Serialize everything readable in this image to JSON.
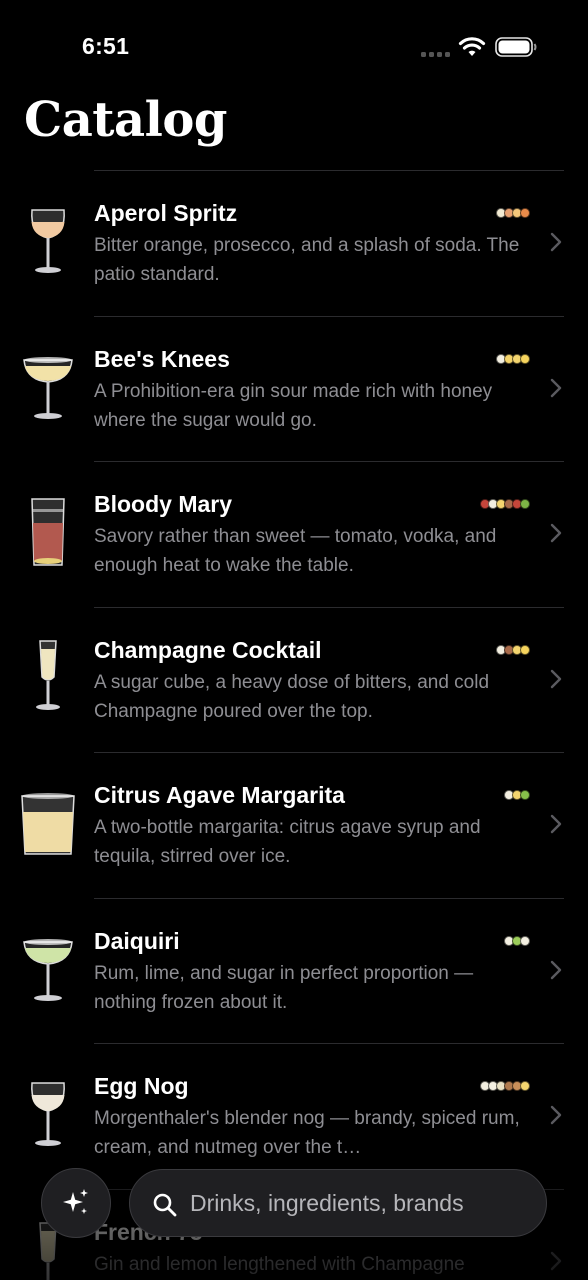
{
  "status": {
    "time": "6:51"
  },
  "page": {
    "title": "Catalog"
  },
  "search": {
    "placeholder": "Drinks, ingredients, brands"
  },
  "drinks": [
    {
      "name": "Aperol Spritz",
      "description": "Bitter orange, prosecco, and a splash of soda. The patio standard.",
      "glass": "wine",
      "liquid": "#f1c9a1",
      "dots": [
        "#f2ead2",
        "#e8a070",
        "#f4c77a",
        "#e98b4a"
      ]
    },
    {
      "name": "Bee's Knees",
      "description": "A Prohibition-era gin sour made rich with honey where the sugar would go.",
      "glass": "coupe",
      "liquid": "#f2e2a8",
      "dots": [
        "#f3efe1",
        "#f4d36a",
        "#f4d56f",
        "#f6d45e"
      ]
    },
    {
      "name": "Bloody Mary",
      "description": "Savory rather than sweet — tomato, vodka, and enough heat to wake the table.",
      "glass": "highball",
      "liquid": "#b2594f",
      "dots": [
        "#c4453b",
        "#f3efe1",
        "#f4d56f",
        "#a86a4a",
        "#c5463a",
        "#7db446"
      ]
    },
    {
      "name": "Champagne Cocktail",
      "description": "A sugar cube, a heavy dose of bitters, and cold Champagne poured over the top.",
      "glass": "flute",
      "liquid": "#efe6c0",
      "dots": [
        "#f3efe1",
        "#a86a4a",
        "#f4d56f",
        "#f6d45e"
      ]
    },
    {
      "name": "Citrus Agave Margarita",
      "description": "A two-bottle margarita: citrus agave syrup and tequila, stirred over ice.",
      "glass": "rocks",
      "liquid": "#efdca5",
      "dots": [
        "#f3efe1",
        "#f4d56f",
        "#86c04a"
      ]
    },
    {
      "name": "Daiquiri",
      "description": "Rum, lime, and sugar in perfect proportion — nothing frozen about it.",
      "glass": "coupe",
      "liquid": "#cfe4a7",
      "dots": [
        "#f3efe1",
        "#9ccd5a",
        "#f3efe1"
      ]
    },
    {
      "name": "Egg Nog",
      "description": "Morgenthaler's blender nog — brandy, spiced rum, cream, and nutmeg over the t…",
      "glass": "wine",
      "liquid": "#efe8da",
      "dots": [
        "#f3efe1",
        "#f3efe1",
        "#e9e1c4",
        "#b07a4e",
        "#c98f5a",
        "#f4d56f"
      ]
    },
    {
      "name": "French 75",
      "description": "Gin and lemon lengthened with Champagne",
      "glass": "flute",
      "liquid": "#efe6c0",
      "dots": []
    }
  ]
}
